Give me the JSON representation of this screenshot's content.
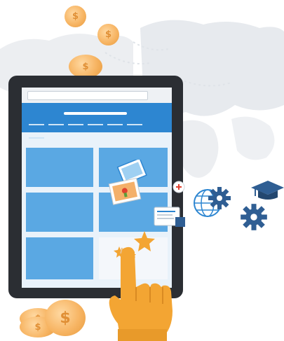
{
  "illustration": {
    "icons": [
      "coin-icon",
      "tablet-icon",
      "photo-icon",
      "pin-icon",
      "document-icon",
      "globe-icon",
      "gear-icon",
      "graduation-cap-icon",
      "star-icon",
      "hand-pointer-icon"
    ],
    "colors": {
      "tablet_frame": "#2b2e33",
      "screen_header": "#2d86d1",
      "screen_tile": "#5aa8e3",
      "coin": "#f7b564",
      "hand": "#f3a533",
      "gear": "#2f5e93",
      "map": "#e7eaee"
    }
  }
}
